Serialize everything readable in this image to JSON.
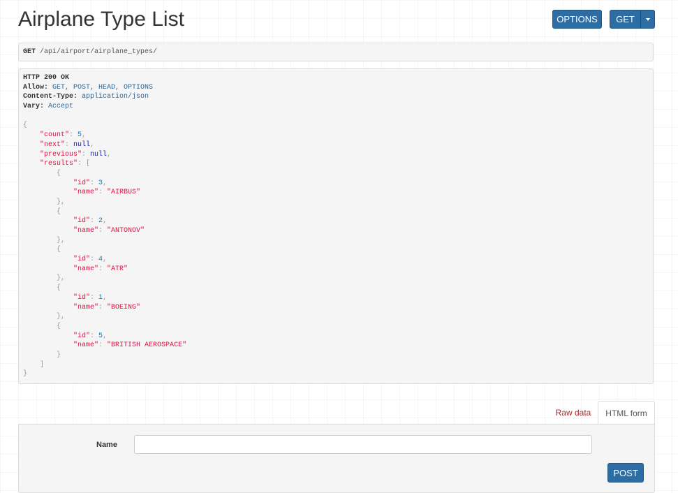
{
  "header": {
    "title": "Airplane Type List",
    "options_label": "OPTIONS",
    "get_label": "GET"
  },
  "request": {
    "method": "GET",
    "path": "/api/airport/airplane_types/"
  },
  "response": {
    "status": "HTTP 200 OK",
    "headers": [
      {
        "name": "Allow:",
        "value": "GET, POST, HEAD, OPTIONS"
      },
      {
        "name": "Content-Type:",
        "value": "application/json"
      },
      {
        "name": "Vary:",
        "value": "Accept"
      }
    ],
    "body": {
      "count": 5,
      "next": null,
      "previous": null,
      "results": [
        {
          "id": 3,
          "name": "AIRBUS"
        },
        {
          "id": 2,
          "name": "ANTONOV"
        },
        {
          "id": 4,
          "name": "ATR"
        },
        {
          "id": 1,
          "name": "BOEING"
        },
        {
          "id": 5,
          "name": "BRITISH AEROSPACE"
        }
      ]
    }
  },
  "tabs": [
    {
      "label": "Raw data",
      "active": false
    },
    {
      "label": "HTML form",
      "active": true
    }
  ],
  "form": {
    "name_label": "Name",
    "name_value": "",
    "name_placeholder": "",
    "post_label": "POST"
  },
  "colors": {
    "primary_button": "#2e6da4",
    "json_string": "#dd1144",
    "json_number": "#1a7ca8",
    "raw_tab_text": "#a52a2a"
  }
}
